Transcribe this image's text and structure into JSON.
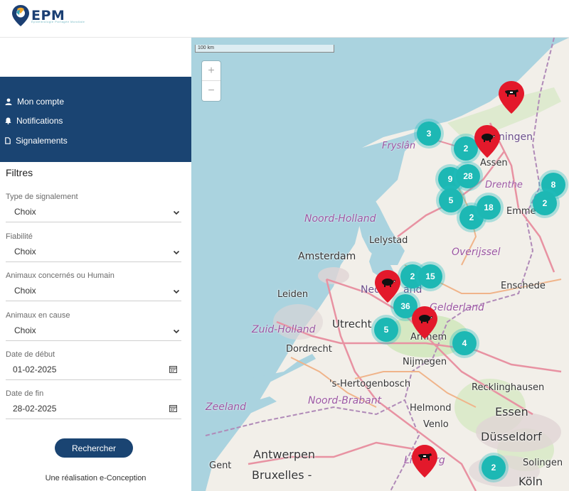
{
  "brand": {
    "name": "EPM",
    "tagline": "Épidémiologie Partagée Mondiale"
  },
  "nav": {
    "items": [
      {
        "label": "Mon compte",
        "icon": "user-icon"
      },
      {
        "label": "Notifications",
        "icon": "bell-icon"
      },
      {
        "label": "Signalements",
        "icon": "document-icon"
      }
    ]
  },
  "filters": {
    "title": "Filtres",
    "type": {
      "label": "Type de signalement",
      "value": "Choix"
    },
    "reliability": {
      "label": "Fiabilité",
      "value": "Choix"
    },
    "animals_concerned": {
      "label": "Animaux concernés ou Humain",
      "value": "Choix"
    },
    "animals_cause": {
      "label": "Animaux en cause",
      "value": "Choix"
    },
    "start_date": {
      "label": "Date de début",
      "value": "01-02-2025"
    },
    "end_date": {
      "label": "Date de fin",
      "value": "28-02-2025"
    },
    "search_label": "Rechercher"
  },
  "footer": {
    "credit": "Une réalisation e-Conception"
  },
  "map": {
    "scale_label": "100 km",
    "zoom_in": "+",
    "zoom_out": "−",
    "cities": {
      "amsterdam": "Amsterdam",
      "lelystad": "Lelystad",
      "leiden": "Leiden",
      "utrecht": "Utrecht",
      "dordrecht": "Dordrecht",
      "arnhem": "Arnhem",
      "nijmegen": "Nijmegen",
      "den_bosch": "'s-Hertogenbosch",
      "helmond": "Helmond",
      "venlo": "Venlo",
      "essen": "Essen",
      "duesseldorf": "Düsseldorf",
      "recklinghausen": "Recklinghausen",
      "enschede": "Enschede",
      "assen": "Assen",
      "emmen": "Emme",
      "groningen": "ningen",
      "antwerpen": "Antwerpen",
      "bruxelles": "Bruxelles -",
      "gent": "Gent",
      "solingen": "Solingen",
      "koln": "Köln",
      "nederland": "Neder",
      "nederland2": "and"
    },
    "regions": {
      "fryslan": "Fryslân",
      "drenthe": "Drenthe",
      "noord_holland": "Noord-Holland",
      "overijssel": "Overijssel",
      "zuid_holland": "Zuid-Holland",
      "gelderland": "Gelderland",
      "noord_brabant": "Noord-Brabant",
      "zeeland": "Zeeland",
      "limburg": "Limburg"
    },
    "clusters": [
      "3",
      "2",
      "9",
      "28",
      "5",
      "2",
      "18",
      "8",
      "2",
      "2",
      "15",
      "36",
      "5",
      "4",
      "2"
    ],
    "marker_icons": [
      "cow-icon",
      "pig-icon",
      "pig-icon",
      "pig-icon",
      "cow-icon"
    ],
    "colors": {
      "marker": "#e3192b",
      "cluster": "#1db8b4",
      "nav": "#1a4472"
    }
  }
}
